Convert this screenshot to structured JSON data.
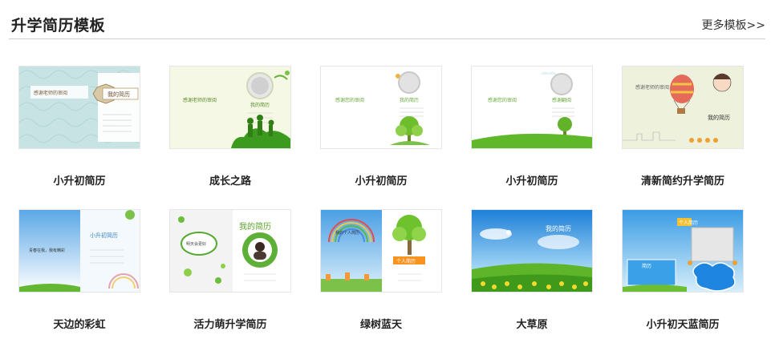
{
  "header": {
    "title": "升学简历模板",
    "more_link": "更多模板>>"
  },
  "templates": [
    {
      "label": "小升初简历",
      "thumb_text": {
        "line1": "感谢老师的审阅",
        "line2": "我的简历"
      }
    },
    {
      "label": "成长之路",
      "thumb_text": {
        "line1": "感谢老师的审阅",
        "line2": "我的简历"
      }
    },
    {
      "label": "小升初简历",
      "thumb_text": {
        "line1": "感谢您的审阅",
        "line2": "我的简历"
      }
    },
    {
      "label": "小升初简历",
      "thumb_text": {
        "line1": "感谢您的审阅",
        "line2": "感谢翻阅"
      }
    },
    {
      "label": "清新简约升学简历",
      "thumb_text": {
        "line1": "感谢老师的审阅",
        "line2": "我的简历"
      }
    },
    {
      "label": "天边的彩虹",
      "thumb_text": {
        "line1": "小升初简历",
        "line2": "青春在我，我有精彩"
      }
    },
    {
      "label": "活力萌升学简历",
      "thumb_text": {
        "line1": "我的简历",
        "line2": "明天会更好"
      }
    },
    {
      "label": "绿树蓝天",
      "thumb_text": {
        "line1": "我的个人简历",
        "line2": "个人简历"
      }
    },
    {
      "label": "大草原",
      "thumb_text": {
        "line1": "我的简历",
        "line2": ""
      }
    },
    {
      "label": "小升初天蓝简历",
      "thumb_text": {
        "line1": "个人简历",
        "line2": "简历"
      }
    }
  ],
  "colors": {
    "title": "#222222",
    "divider": "#cfcfcf",
    "grass": "#4caf28",
    "sky": "#4aa3e8"
  }
}
